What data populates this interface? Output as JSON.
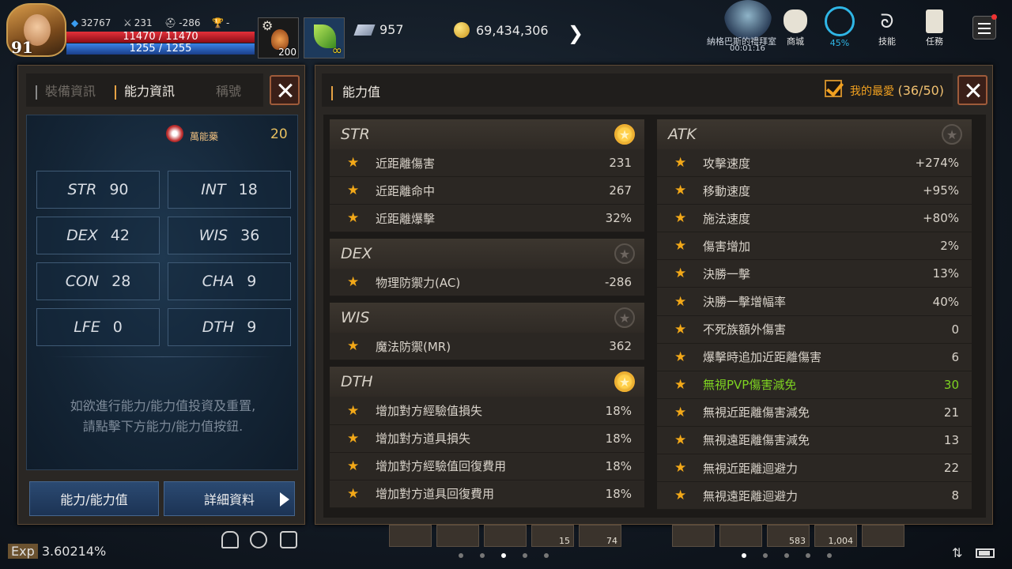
{
  "player": {
    "level": "91",
    "mp_stat": "32767",
    "attack_stat": "231",
    "defense_stat": "-286",
    "trophy_stat": "-",
    "hp": "11470 / 11470",
    "mp": "1255 / 1255"
  },
  "quickslots": {
    "potion_count": "200",
    "leaf_count": "∞"
  },
  "currency": {
    "gems": "957",
    "gold": "69,434,306"
  },
  "boss": {
    "name": "納格巴斯的禮拜室",
    "time": "00:01:16"
  },
  "top_icons": {
    "shop": "商城",
    "weight": "45%",
    "skills": "技能",
    "quests": "任務"
  },
  "left_panel": {
    "tabs": [
      "裝備資訊",
      "能力資訊",
      "稱號"
    ],
    "potion_label": "萬能藥",
    "potion_count": "20",
    "stats": [
      {
        "name": "STR",
        "value": "90"
      },
      {
        "name": "INT",
        "value": "18"
      },
      {
        "name": "DEX",
        "value": "42"
      },
      {
        "name": "WIS",
        "value": "36"
      },
      {
        "name": "CON",
        "value": "28"
      },
      {
        "name": "CHA",
        "value": "9"
      },
      {
        "name": "LFE",
        "value": "0"
      },
      {
        "name": "DTH",
        "value": "9"
      }
    ],
    "hint": "如欲進行能力/能力值投資及重置,\n請點擊下方能力/能力值按鈕.",
    "button_ability": "能力/能力值",
    "button_details": "詳細資料"
  },
  "right_panel": {
    "title": "能力值",
    "favorite_label": "我的最愛",
    "favorite_count": "(36/50)",
    "left_groups": [
      {
        "name": "STR",
        "fav": true,
        "rows": [
          {
            "label": "近距離傷害",
            "value": "231"
          },
          {
            "label": "近距離命中",
            "value": "267"
          },
          {
            "label": "近距離爆擊",
            "value": "32%"
          }
        ]
      },
      {
        "name": "DEX",
        "fav": false,
        "rows": [
          {
            "label": "物理防禦力(AC)",
            "value": "-286"
          }
        ]
      },
      {
        "name": "WIS",
        "fav": false,
        "rows": [
          {
            "label": "魔法防禦(MR)",
            "value": "362"
          }
        ]
      },
      {
        "name": "DTH",
        "fav": true,
        "rows": [
          {
            "label": "增加對方經驗值損失",
            "value": "18%"
          },
          {
            "label": "增加對方道具損失",
            "value": "18%"
          },
          {
            "label": "增加對方經驗值回復費用",
            "value": "18%"
          },
          {
            "label": "增加對方道具回復費用",
            "value": "18%"
          }
        ]
      }
    ],
    "right_group": {
      "name": "ATK",
      "fav": false,
      "rows": [
        {
          "label": "攻擊速度",
          "value": "+274%"
        },
        {
          "label": "移動速度",
          "value": "+95%"
        },
        {
          "label": "施法速度",
          "value": "+80%"
        },
        {
          "label": "傷害增加",
          "value": "2%"
        },
        {
          "label": "決勝一擊",
          "value": "13%"
        },
        {
          "label": "決勝一擊增幅率",
          "value": "40%"
        },
        {
          "label": "不死族額外傷害",
          "value": "0"
        },
        {
          "label": "爆擊時追加近距離傷害",
          "value": "6"
        },
        {
          "label": "無視PVP傷害減免",
          "value": "30",
          "green": true
        },
        {
          "label": "無視近距離傷害減免",
          "value": "21"
        },
        {
          "label": "無視遠距離傷害減免",
          "value": "13"
        },
        {
          "label": "無視近距離迴避力",
          "value": "22"
        },
        {
          "label": "無視遠距離迴避力",
          "value": "8"
        }
      ]
    }
  },
  "bottom": {
    "exp_label": "Exp",
    "exp_value": "3.60214%",
    "slot_counts": [
      "15",
      "74",
      "583",
      "1,004"
    ]
  },
  "colors": {
    "accent_orange": "#e6a244",
    "star_gold": "#f2a818",
    "green_value": "#7ed321",
    "hp_red": "#e4313a",
    "mp_blue": "#3a82e6"
  }
}
